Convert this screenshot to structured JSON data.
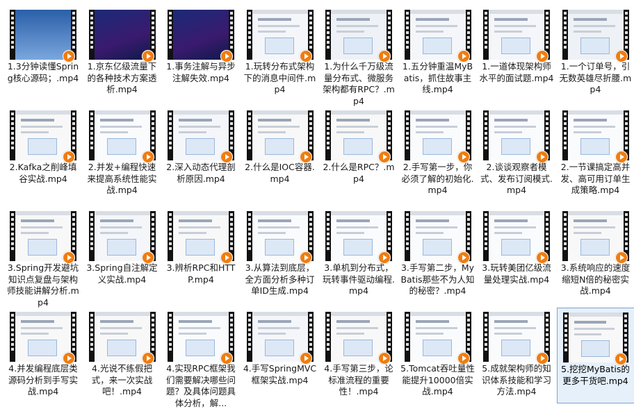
{
  "colors": {
    "background": "#ffffff",
    "filmstrip": "#111111",
    "play_badge": "#f07d10",
    "selection_border": "#7da2ce",
    "selection_fill": "#e5f0fb"
  },
  "selected_index": 31,
  "files": [
    {
      "label": "1.3分钟读懂Spring核心源码；.mp4",
      "screen": "blue-slide"
    },
    {
      "label": "1.京东亿级流量下的各种技术方案透析.mp4",
      "screen": "dark-poster"
    },
    {
      "label": "1.事务注解与异步注解失效.mp4",
      "screen": "dark-poster"
    },
    {
      "label": "1.玩转分布式架构下的消息中间件.mp4",
      "screen": "slide"
    },
    {
      "label": "1.为什么千万级流量分布式、微服务架构都有RPC？.mp4",
      "screen": "presenter"
    },
    {
      "label": "1.五分钟重温MyBatis，抓住故事主线.mp4",
      "screen": "slide"
    },
    {
      "label": "1.一道体现架构师水平的面试题.mp4",
      "screen": "slide"
    },
    {
      "label": "1.一个订单号，引无数英雄尽折腰.mp4",
      "screen": "presenter"
    },
    {
      "label": "2.Kafka之削峰填谷实战.mp4",
      "screen": "ide"
    },
    {
      "label": "2.并发+编程快速来提高系统性能实战.mp4",
      "screen": "diagram"
    },
    {
      "label": "2.深入动态代理剖析原因.mp4",
      "screen": "slide"
    },
    {
      "label": "2.什么是IOC容器.mp4",
      "screen": "ide"
    },
    {
      "label": "2.什么是RPC？.mp4",
      "screen": "ide"
    },
    {
      "label": "2.手写第一步，你必须了解的初始化.mp4",
      "screen": "diagram"
    },
    {
      "label": "2.谈谈观察者模式、发布订阅模式.mp4",
      "screen": "diagram"
    },
    {
      "label": "2.一节课搞定高并发、高可用订单生成策略.mp4",
      "screen": "diagram"
    },
    {
      "label": "3.Spring开发避坑知识点复盘与架构师技能讲解分析.mp4",
      "screen": "ide"
    },
    {
      "label": "3.Spring自注解定义实战.mp4",
      "screen": "slide"
    },
    {
      "label": "3.辨析RPC和HTTP.mp4",
      "screen": "ide"
    },
    {
      "label": "3.从算法到底层，全方面分析多种订单ID生成.mp4",
      "screen": "diagram"
    },
    {
      "label": "3.单机到分布式，玩转事件驱动编程.mp4",
      "screen": "diagram"
    },
    {
      "label": "3.手写第二步，MyBatis那些不为人知的秘密？.mp4",
      "screen": "diagram"
    },
    {
      "label": "3.玩转美团亿级流量处理实战.mp4",
      "screen": "diagram"
    },
    {
      "label": "3.系统响应的速度缩短N倍的秘密实战.mp4",
      "screen": "ide"
    },
    {
      "label": "4.并发编程底层类源码分析到手写实战.mp4",
      "screen": "ide"
    },
    {
      "label": "4.光说不练假把式，来一次实战吧！.mp4",
      "screen": "ide"
    },
    {
      "label": "4.实现RPC框架我们需要解决哪些问题？及具体问题具体分析，解...",
      "screen": "diagram"
    },
    {
      "label": "4.手写SpringMVC框架实战.mp4",
      "screen": "slide"
    },
    {
      "label": "4.手写第三步，论标准流程的重要性！.mp4",
      "screen": "ide"
    },
    {
      "label": "5.Tomcat吞吐量性能提升10000倍实战.mp4",
      "screen": "diagram"
    },
    {
      "label": "5.成就架构师的知识体系技能和学习方法.mp4",
      "screen": "diagram"
    },
    {
      "label": "5.挖挖MyBatis的更多干货吧.mp4",
      "screen": "ide"
    }
  ]
}
